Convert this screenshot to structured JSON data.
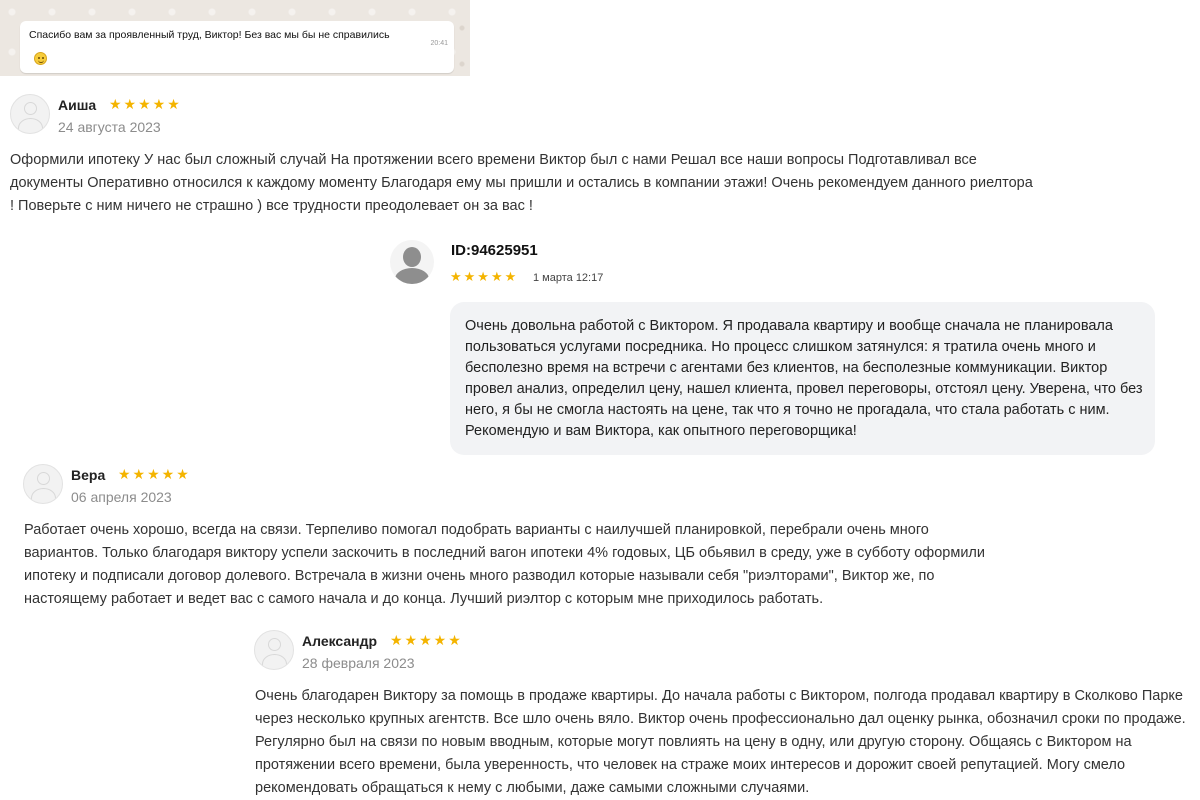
{
  "chat": {
    "message": "Спасибо вам за проявленный труд, Виктор! Без вас мы бы не справились",
    "time": "20:41",
    "emoji_icon": "smiley-emoji"
  },
  "reviews": [
    {
      "name": "Аиша",
      "stars": "★★★★★",
      "date": "24 августа 2023",
      "text": "Оформили ипотеку У нас был сложный случай На протяжении всего времени Виктор был с нами Решал все наши вопросы Подготавливал все документы Оперативно относился к каждому моменту Благодаря ему мы пришли и остались в компании этажи! Очень рекомендуем данного риелтора ! Поверьте с ним ничего не страшно ) все трудности преодолевает он за вас !"
    },
    {
      "name": "Вера",
      "stars": "★★★★★",
      "date": "06 апреля 2023",
      "text": "Работает очень хорошо, всегда на связи. Терпеливо помогал подобрать варианты с наилучшей планировкой, перебрали очень много вариантов. Только благодаря виктору успели заскочить в последний вагон ипотеки 4% годовых, ЦБ обьявил в среду, уже в субботу оформили ипотеку и подписали договор долевого. Встречала в жизни очень много разводил которые называли себя \"риэлторами\", Виктор же, по настоящему работает и ведет вас с самого начала и до конца. Лучший риэлтор с которым мне приходилось работать."
    },
    {
      "name": "Александр",
      "stars": "★★★★★",
      "date": "28 февраля 2023",
      "text": "Очень благодарен Виктору за помощь в продаже квартиры. До начала работы с Виктором, полгода продавал квартиру в Сколково Парке через несколько крупных агентств. Все шло очень вяло. Виктор очень профессионально дал оценку рынка, обозначил сроки по продаже. Регулярно был на связи по новым вводным, которые могут повлиять на цену в одну, или другую сторону. Общаясь с Виктором на протяжении всего времени, была уверенность, что человек на страже моих интересов и дорожит своей репутацией. Могу смело рекомендовать обращаться к нему с любыми, даже самыми сложными случаями."
    }
  ],
  "avito_review": {
    "user_id": "ID:94625951",
    "stars": "★★★★★",
    "date": "1 марта 12:17",
    "text": "Очень довольна работой с Виктором. Я продавала квартиру и вообще сначала не планировала пользоваться услугами посредника. Но процесс слишком затянулся: я тратила очень много и бесполезно время на встречи с агентами без клиентов, на бесполезные коммуникации. Виктор провел анализ, определил цену, нашел клиента, провел переговоры, отстоял цену. Уверена, что без него, я бы не смогла настоять на цене, так что я точно не прогадала, что стала работать с ним. Рекомендую и вам Виктора, как опытного переговорщика!"
  },
  "colors": {
    "star": "#f4b400",
    "bubble": "#f2f3f5",
    "chat_background": "#ece7e1"
  }
}
